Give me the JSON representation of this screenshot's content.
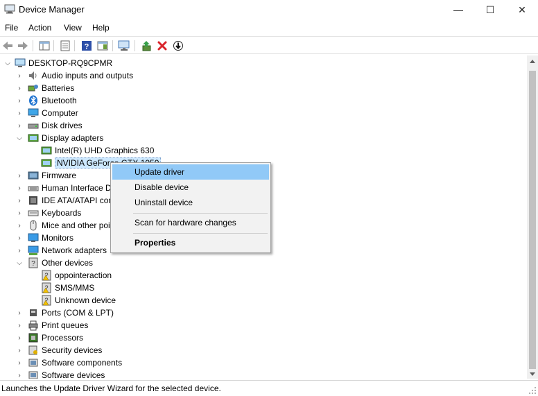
{
  "window": {
    "title": "Device Manager",
    "minimize_glyph": "—",
    "maximize_glyph": "☐",
    "close_glyph": "✕"
  },
  "menu": [
    "File",
    "Action",
    "View",
    "Help"
  ],
  "toolbar": {
    "icons": [
      "back-icon",
      "forward-icon",
      "show-hide-tree-icon",
      "properties-icon",
      "help-icon",
      "action-pane-icon",
      "scan-hardware-icon",
      "update-driver-icon",
      "uninstall-icon",
      "disable-icon"
    ]
  },
  "tree": {
    "root": "DESKTOP-RQ9CPMR",
    "items": [
      {
        "label": "Audio inputs and outputs",
        "icon": "speaker-icon",
        "state": "collapsed"
      },
      {
        "label": "Batteries",
        "icon": "battery-icon",
        "state": "collapsed"
      },
      {
        "label": "Bluetooth",
        "icon": "bluetooth-icon",
        "state": "collapsed"
      },
      {
        "label": "Computer",
        "icon": "computer-icon",
        "state": "collapsed"
      },
      {
        "label": "Disk drives",
        "icon": "disk-drive-icon",
        "state": "collapsed"
      },
      {
        "label": "Display adapters",
        "icon": "display-adapter-icon",
        "state": "expanded"
      },
      {
        "label": "Intel(R) UHD Graphics 630",
        "icon": "display-adapter-icon",
        "child": true
      },
      {
        "label": "NVIDIA GeForce GTX 1050",
        "icon": "display-adapter-icon",
        "child": true,
        "selected": true
      },
      {
        "label": "Firmware",
        "icon": "firmware-icon",
        "state": "collapsed"
      },
      {
        "label": "Human Interface Devices",
        "icon": "hid-icon",
        "state": "collapsed"
      },
      {
        "label": "IDE ATA/ATAPI controllers",
        "icon": "ide-controller-icon",
        "state": "collapsed"
      },
      {
        "label": "Keyboards",
        "icon": "keyboard-icon",
        "state": "collapsed"
      },
      {
        "label": "Mice and other pointing devices",
        "icon": "mouse-icon",
        "state": "collapsed"
      },
      {
        "label": "Monitors",
        "icon": "monitor-icon",
        "state": "collapsed"
      },
      {
        "label": "Network adapters",
        "icon": "network-adapter-icon",
        "state": "collapsed"
      },
      {
        "label": "Other devices",
        "icon": "unknown-device-icon",
        "state": "expanded"
      },
      {
        "label": "oppointeraction",
        "icon": "unknown-device-warning-icon",
        "child": true
      },
      {
        "label": "SMS/MMS",
        "icon": "unknown-device-warning-icon",
        "child": true
      },
      {
        "label": "Unknown device",
        "icon": "unknown-device-warning-icon",
        "child": true
      },
      {
        "label": "Ports (COM & LPT)",
        "icon": "port-icon",
        "state": "collapsed"
      },
      {
        "label": "Print queues",
        "icon": "printer-icon",
        "state": "collapsed"
      },
      {
        "label": "Processors",
        "icon": "processor-icon",
        "state": "collapsed"
      },
      {
        "label": "Security devices",
        "icon": "security-device-icon",
        "state": "collapsed"
      },
      {
        "label": "Software components",
        "icon": "software-component-icon",
        "state": "collapsed"
      },
      {
        "label": "Software devices",
        "icon": "software-device-icon",
        "state": "collapsed"
      }
    ]
  },
  "context_menu": {
    "update_driver": "Update driver",
    "disable_device": "Disable device",
    "uninstall_device": "Uninstall device",
    "scan_hardware": "Scan for hardware changes",
    "properties": "Properties"
  },
  "status": "Launches the Update Driver Wizard for the selected device.",
  "colors": {
    "selection": "#cce8ff",
    "menu_highlight": "#91c9f7",
    "remove_red": "#d9232a",
    "icon_blue": "#2d7bd6"
  }
}
